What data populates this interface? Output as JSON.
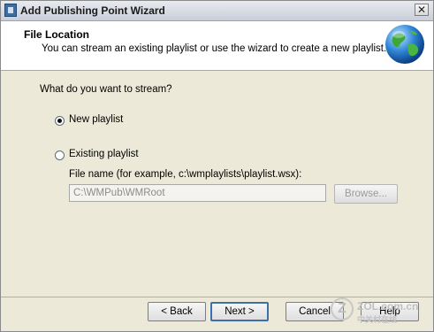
{
  "window": {
    "title": "Add Publishing Point Wizard",
    "close_glyph": "✕"
  },
  "header": {
    "title": "File Location",
    "subtitle": "You can stream an existing playlist or use the wizard to create a new playlist."
  },
  "form": {
    "question": "What do you want to stream?",
    "option_new": "New playlist",
    "option_existing": "Existing playlist",
    "selected": "New playlist",
    "file_name_label": "File name (for example, c:\\wmplaylists\\playlist.wsx):",
    "file_name_value": "C:\\WMPub\\WMRoot",
    "browse_label": "Browse..."
  },
  "buttons": {
    "back": "< Back",
    "next": "Next >",
    "cancel": "Cancel",
    "help": "Help"
  },
  "watermark": {
    "site": "ZOL.com.cn",
    "cn": "中关村在线"
  },
  "icons": {
    "app": "wizard-app-icon",
    "globe": "globe-icon"
  },
  "colors": {
    "accent": "#3d6fa8"
  }
}
